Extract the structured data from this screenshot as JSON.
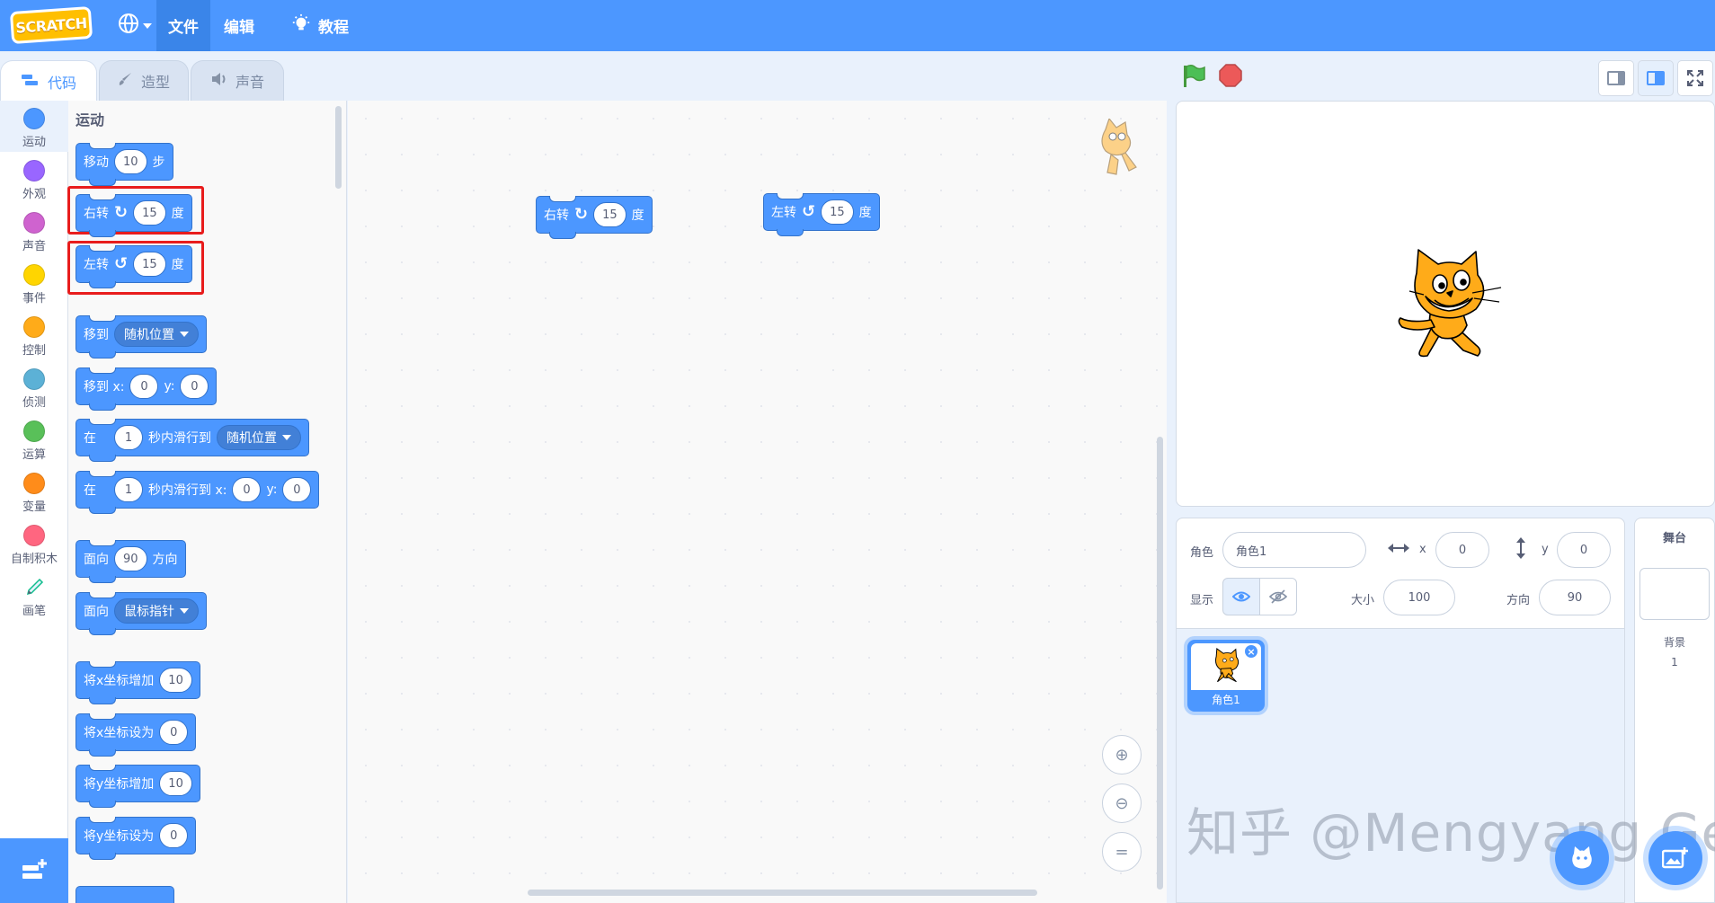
{
  "menubar": {
    "logo": "SCRATCH",
    "file": "文件",
    "edit": "编辑",
    "tutorials": "教程"
  },
  "tabs": {
    "code": "代码",
    "costumes": "造型",
    "sounds": "声音"
  },
  "categories": [
    {
      "label": "运动",
      "color": "#4c97ff"
    },
    {
      "label": "外观",
      "color": "#9966ff"
    },
    {
      "label": "声音",
      "color": "#cf63cf"
    },
    {
      "label": "事件",
      "color": "#ffd500"
    },
    {
      "label": "控制",
      "color": "#ffab19"
    },
    {
      "label": "侦测",
      "color": "#5cb1d6"
    },
    {
      "label": "运算",
      "color": "#59c059"
    },
    {
      "label": "变量",
      "color": "#ff8c1a"
    },
    {
      "label": "自制积木",
      "color": "#ff6680"
    },
    {
      "label": "画笔",
      "color": "#0fbd8c"
    }
  ],
  "palette": {
    "section_title": "运动",
    "move": {
      "pre": "移动",
      "val": "10",
      "post": "步"
    },
    "turn_right": {
      "pre": "右转",
      "val": "15",
      "post": "度"
    },
    "turn_left": {
      "pre": "左转",
      "val": "15",
      "post": "度"
    },
    "goto": {
      "pre": "移到",
      "dd": "随机位置"
    },
    "goto_xy": {
      "pre": "移到 x:",
      "x": "0",
      "ylabel": "y:",
      "y": "0"
    },
    "glide_to": {
      "pre": "在",
      "secs": "1",
      "mid": "秒内滑行到",
      "dd": "随机位置"
    },
    "glide_xy": {
      "pre": "在",
      "secs": "1",
      "mid": "秒内滑行到 x:",
      "x": "0",
      "ylabel": "y:",
      "y": "0"
    },
    "point_dir": {
      "pre": "面向",
      "val": "90",
      "post": "方向"
    },
    "point_towards": {
      "pre": "面向",
      "dd": "鼠标指针"
    },
    "change_x": {
      "pre": "将x坐标增加",
      "val": "10"
    },
    "set_x": {
      "pre": "将x坐标设为",
      "val": "0"
    },
    "change_y": {
      "pre": "将y坐标增加",
      "val": "10"
    },
    "set_y": {
      "pre": "将y坐标设为",
      "val": "0"
    }
  },
  "workspace": {
    "block1": {
      "pre": "右转",
      "val": "15",
      "post": "度"
    },
    "block2": {
      "pre": "左转",
      "val": "15",
      "post": "度"
    }
  },
  "sprite_info": {
    "sprite_label": "角色",
    "sprite_name": "角色1",
    "x_label": "x",
    "x": "0",
    "y_label": "y",
    "y": "0",
    "show_label": "显示",
    "size_label": "大小",
    "size": "100",
    "direction_label": "方向",
    "direction": "90"
  },
  "sprite_list": [
    {
      "name": "角色1"
    }
  ],
  "stage_panel": {
    "title": "舞台",
    "backdrops_label": "背景",
    "backdrops_count": "1"
  },
  "watermark": "知乎 @Mengyang Ge",
  "colors": {
    "accent": "#4c97ff",
    "highlight": "#e81c1c"
  }
}
